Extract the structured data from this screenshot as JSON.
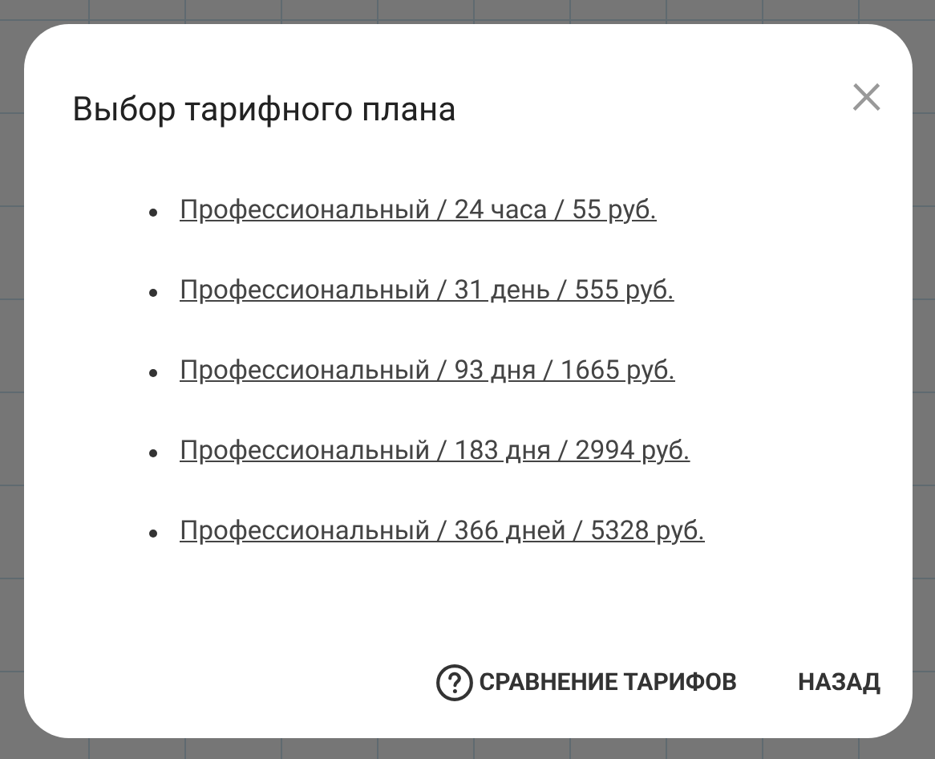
{
  "dialog": {
    "title": "Выбор тарифного плана",
    "close": "×"
  },
  "plans": [
    {
      "label": "Профессиональный / 24 часа / 55 руб."
    },
    {
      "label": "Профессиональный / 31 день / 555 руб."
    },
    {
      "label": "Профессиональный / 93 дня / 1665 руб."
    },
    {
      "label": "Профессиональный / 183 дня / 2994 руб."
    },
    {
      "label": "Профессиональный / 366 дней / 5328 руб."
    }
  ],
  "buttons": [
    {
      "kind": "help",
      "label": "СРАВНЕНИЕ ТАРИФОВ"
    },
    {
      "kind": "plain",
      "label": "НАЗАД"
    }
  ]
}
